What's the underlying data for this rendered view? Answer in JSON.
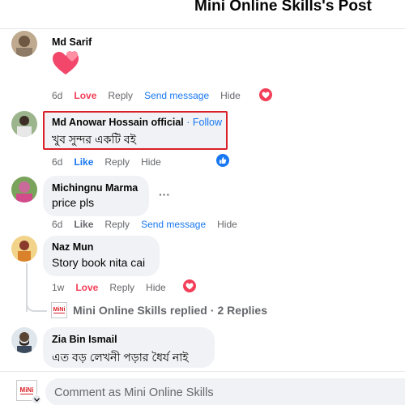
{
  "header": {
    "title": "Mini Online Skills's Post"
  },
  "comments": [
    {
      "author": "Md Sarif",
      "text": "",
      "time": "6d",
      "reaction_label": "Love",
      "reply": "Reply",
      "message": "Send message",
      "hide": "Hide"
    },
    {
      "author": "Md Anowar Hossain official",
      "follow": "Follow",
      "dot": "·",
      "text": "খুব সুন্দর একটি বই",
      "time": "6d",
      "reaction_label": "Like",
      "reply": "Reply",
      "hide": "Hide"
    },
    {
      "author": "Michingnu Marma",
      "text": "price pls",
      "time": "6d",
      "reaction_label": "Like",
      "reply": "Reply",
      "message": "Send message",
      "hide": "Hide",
      "more": "···"
    },
    {
      "author": "Naz Mun",
      "text": "Story book nita cai",
      "time": "1w",
      "reaction_label": "Love",
      "reply": "Reply",
      "hide": "Hide"
    },
    {
      "author": "Zia Bin Ismail",
      "text": "এত বড় লেখনী পড়ার ধৈর্য নাই"
    }
  ],
  "replies_line": {
    "page": "Mini Online Skills",
    "text": "replied",
    "dot": "·",
    "count": "2 Replies"
  },
  "composer": {
    "placeholder": "Comment as Mini Online Skills",
    "logo_text": "MiNi"
  },
  "colors": {
    "love": "#f33e58",
    "like": "#1877f2",
    "highlight": "#d92027",
    "bubble": "#f0f2f5"
  },
  "icons": [
    "heart-emoji-icon",
    "love-reaction-icon",
    "like-reaction-icon",
    "more-options-icon",
    "chevron-down-icon"
  ]
}
